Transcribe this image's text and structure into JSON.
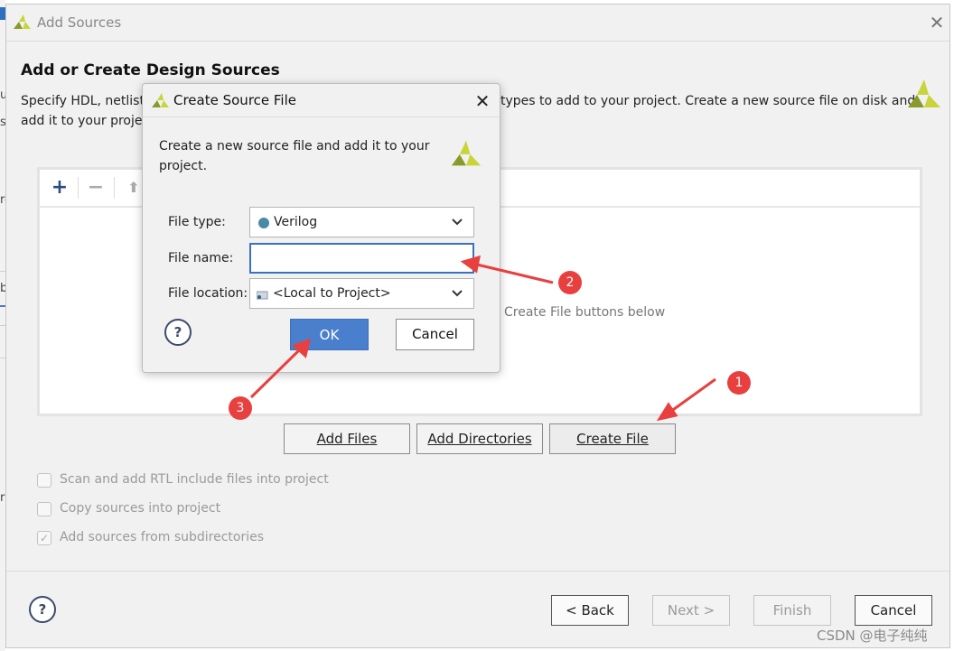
{
  "window": {
    "title": "Add Sources",
    "close_glyph": "✕"
  },
  "main": {
    "heading": "Add or Create Design Sources",
    "desc_part1": "Specify HDL, netlist,",
    "desc_part2": "types to add to your project. Create a new source file on disk and",
    "desc_part3": "add it to your project.",
    "toolbar": {
      "add": "+",
      "remove": "−",
      "up": "⬆"
    },
    "hint": "Create File buttons below",
    "buttons": {
      "add_files": "Add Files",
      "add_directories": "Add Directories",
      "create_file": "Create File"
    },
    "checkboxes": [
      {
        "label": "Scan and add RTL include files into project",
        "checked": false
      },
      {
        "label": "Copy sources into project",
        "checked": false
      },
      {
        "label": "Add sources from subdirectories",
        "checked": true
      }
    ],
    "footer": {
      "help": "?",
      "back": "< Back",
      "next": "Next >",
      "finish": "Finish",
      "cancel": "Cancel"
    }
  },
  "dialog": {
    "title": "Create Source File",
    "close_glyph": "✕",
    "description": "Create a new source file and add it to your project.",
    "file_type_label": "File type:",
    "file_type_value": "Verilog",
    "file_name_label": "File name:",
    "file_name_value": "",
    "file_location_label": "File location:",
    "file_location_value": "<Local to Project>",
    "help": "?",
    "ok": "OK",
    "cancel": "Cancel"
  },
  "annotations": {
    "badge1": "1",
    "badge2": "2",
    "badge3": "3",
    "arrow_color": "#e8403e"
  },
  "watermark": "CSDN @电子纯纯",
  "colors": {
    "accent": "#4a7fce",
    "logo_yellow": "#c8d43a",
    "logo_dark": "#8a9a2a"
  }
}
